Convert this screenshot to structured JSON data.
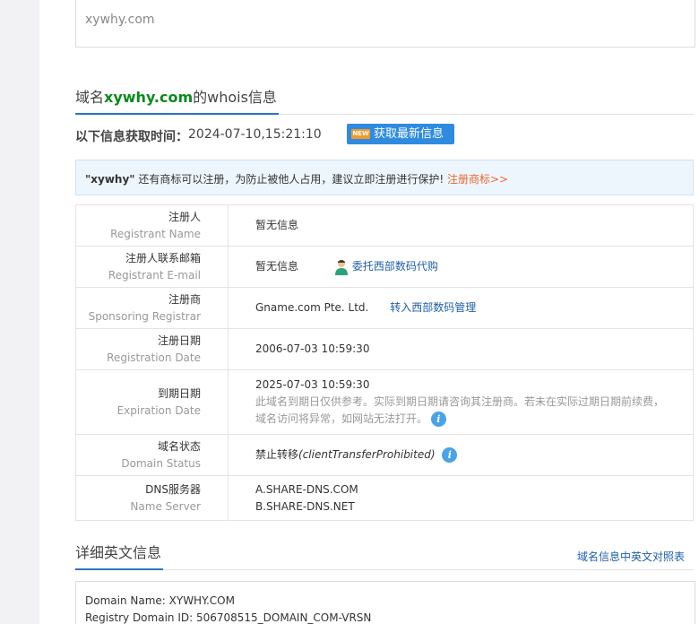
{
  "search": {
    "value": "xywhy.com"
  },
  "whois_section": {
    "title_prefix": "域名",
    "domain": "xywhy.com",
    "title_suffix": "的whois信息"
  },
  "fetch": {
    "label": "以下信息获取时间：",
    "time": "2024-07-10,15:21:10",
    "new_badge": "NEW",
    "refresh_label": "获取最新信息"
  },
  "trademark_notice": {
    "brand": "\"xywhy\"",
    "text": " 还有商标可以注册，为防止被他人占用，建议立即注册进行保护! ",
    "link": "注册商标>>"
  },
  "rows": {
    "registrant": {
      "cn": "注册人",
      "en": "Registrant Name",
      "value": "暂无信息"
    },
    "email": {
      "cn": "注册人联系邮箱",
      "en": "Registrant E-mail",
      "value": "暂无信息",
      "link": "委托西部数码代购"
    },
    "registrar": {
      "cn": "注册商",
      "en": "Sponsoring Registrar",
      "value": "Gname.com Pte. Ltd.",
      "link": "转入西部数码管理"
    },
    "reg_date": {
      "cn": "注册日期",
      "en": "Registration Date",
      "value": "2006-07-03 10:59:30"
    },
    "exp_date": {
      "cn": "到期日期",
      "en": "Expiration Date",
      "value": "2025-07-03 10:59:30",
      "note_line1": "此域名到期日仅供参考。实际到期日期请咨询其注册商。若未在实际过期日期前续费，",
      "note_line2": "域名访问将异常，如网站无法打开。"
    },
    "status": {
      "cn": "域名状态",
      "en": "Domain Status",
      "value": "禁止转移",
      "value_en": "(clientTransferProhibited)"
    },
    "dns": {
      "cn": "DNS服务器",
      "en": "Name Server",
      "ns1": "A.SHARE-DNS.COM",
      "ns2": "B.SHARE-DNS.NET"
    }
  },
  "detail_section": {
    "title": "详细英文信息",
    "right_link": "域名信息中英文对照表"
  },
  "raw": {
    "line1": "Domain Name: XYWHY.COM",
    "line2": "Registry Domain ID: 506708515_DOMAIN_COM-VRSN"
  },
  "icons": {
    "info": "info-icon",
    "agent": "person-icon",
    "new": "new-badge-icon"
  },
  "colors": {
    "accent": "#2b73c8",
    "domain_green": "#0a8a1a",
    "button": "#2e8be0",
    "link_orange": "#e8672a"
  }
}
